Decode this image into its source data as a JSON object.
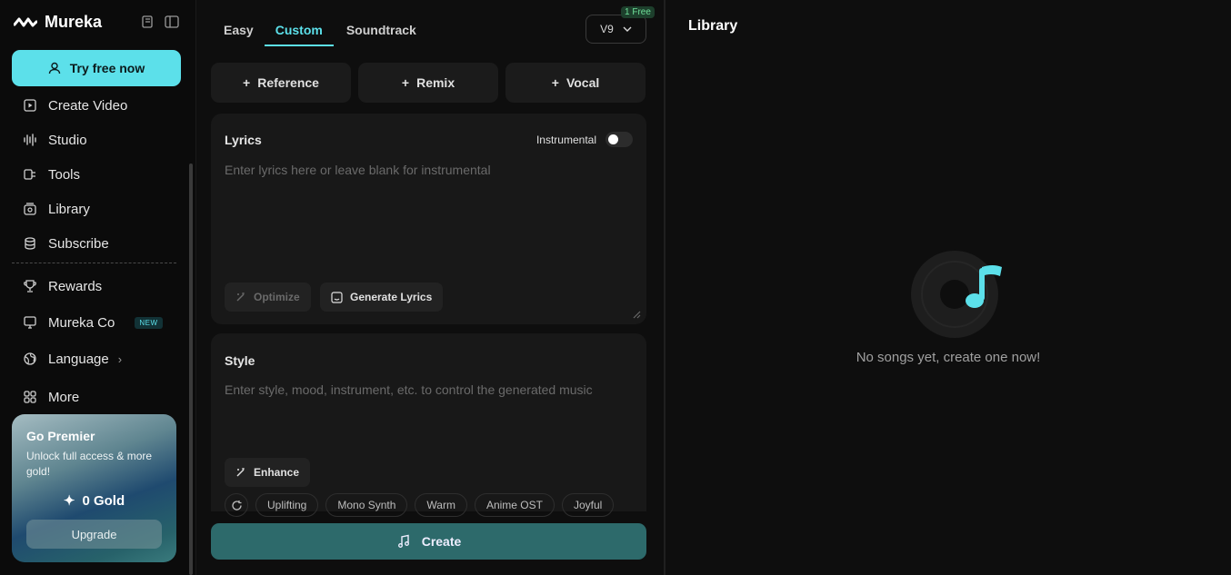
{
  "brand": {
    "name": "Mureka"
  },
  "sidebar": {
    "try_button": "Try free now",
    "items": [
      {
        "label": "Create Video",
        "icon": "video-icon"
      },
      {
        "label": "Studio",
        "icon": "waveform-icon"
      },
      {
        "label": "Tools",
        "icon": "tools-icon"
      },
      {
        "label": "Library",
        "icon": "library-icon"
      },
      {
        "label": "Subscribe",
        "icon": "database-icon"
      },
      {
        "label": "Rewards",
        "icon": "trophy-icon"
      },
      {
        "label": "Mureka Co",
        "icon": "monitor-icon",
        "badge": "NEW"
      },
      {
        "label": "Language",
        "icon": "globe-icon"
      },
      {
        "label": "More",
        "icon": "grid-icon"
      }
    ],
    "premier": {
      "title": "Go Premier",
      "subtitle": "Unlock full access & more gold!",
      "gold": "0 Gold",
      "upgrade": "Upgrade"
    }
  },
  "composer": {
    "tabs": [
      "Easy",
      "Custom",
      "Soundtrack"
    ],
    "active_tab": "Custom",
    "version": "V9",
    "free_badge": "1 Free",
    "chips": [
      "Reference",
      "Remix",
      "Vocal"
    ],
    "lyrics": {
      "title": "Lyrics",
      "instrumental_label": "Instrumental",
      "placeholder": "Enter lyrics here or leave blank for instrumental",
      "optimize": "Optimize",
      "generate": "Generate Lyrics"
    },
    "style": {
      "title": "Style",
      "placeholder": "Enter style, mood, instrument, etc. to control the generated music",
      "enhance": "Enhance",
      "tags": [
        "Uplifting",
        "Mono Synth",
        "Warm",
        "Anime OST",
        "Joyful"
      ]
    },
    "create": "Create"
  },
  "library": {
    "title": "Library",
    "empty": "No songs yet, create one now!"
  },
  "colors": {
    "accent": "#5ce0ea",
    "create": "#2d6a6b"
  }
}
